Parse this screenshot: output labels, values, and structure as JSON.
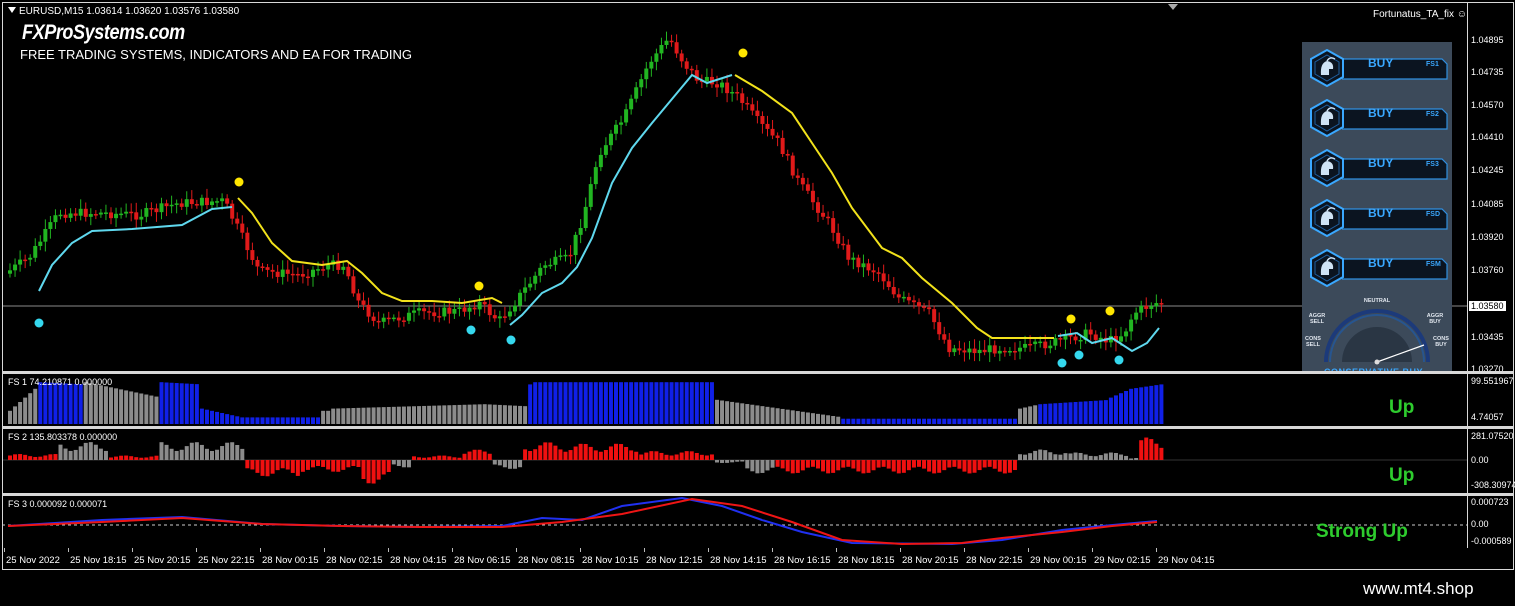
{
  "symbol_line": "EURUSD,M15  1.03614 1.03620 1.03576 1.03580",
  "brand": "FXProSystems.com",
  "tagline": "FREE TRADING SYSTEMS, INDICATORS AND EA FOR TRADING",
  "indicator_name": "Fortunatus_TA_fix",
  "price_labels": [
    "1.04895",
    "1.04735",
    "1.04570",
    "1.04410",
    "1.04245",
    "1.04085",
    "1.03920",
    "1.03760",
    "1.03580",
    "1.03435",
    "1.03270"
  ],
  "current_price": "1.03580",
  "sub1": {
    "header": "FS 1 74.210871 0.000000",
    "scale_top": "99.551967",
    "scale_bottom": "4.74057",
    "state": "Up"
  },
  "sub2": {
    "header": "FS 2 135.803378 0.000000",
    "scale_top": "281.07520",
    "scale_mid": "0.00",
    "scale_bottom": "-308.30974",
    "state": "Up"
  },
  "sub3": {
    "header": "FS 3 0.000092 0.000071",
    "scale_top": "0.000723",
    "scale_mid": "0.00",
    "scale_bottom": "-0.000589",
    "state": "Strong Up"
  },
  "time_labels": [
    "25 Nov 2022",
    "25 Nov 18:15",
    "25 Nov 20:15",
    "25 Nov 22:15",
    "28 Nov 00:15",
    "28 Nov 02:15",
    "28 Nov 04:15",
    "28 Nov 06:15",
    "28 Nov 08:15",
    "28 Nov 10:15",
    "28 Nov 12:15",
    "28 Nov 14:15",
    "28 Nov 16:15",
    "28 Nov 18:15",
    "28 Nov 20:15",
    "28 Nov 22:15",
    "29 Nov 00:15",
    "29 Nov 02:15",
    "29 Nov 04:15"
  ],
  "signal_panel": {
    "buttons": [
      {
        "label": "BUY",
        "code": "FS1"
      },
      {
        "label": "BUY",
        "code": "FS2"
      },
      {
        "label": "BUY",
        "code": "FS3"
      },
      {
        "label": "BUY",
        "code": "FSD"
      },
      {
        "label": "BUY",
        "code": "FSM"
      }
    ],
    "gauge": {
      "neutral": "NEUTRAL",
      "aggr_sell": "AGGR SELL",
      "aggr_buy": "AGGR BUY",
      "cons_sell": "CONS SELL",
      "cons_buy": "CONS BUY",
      "reading": "CONSERVATIVE BUY"
    }
  },
  "footer": "www.mt4.shop",
  "colors": {
    "up": "#21b521",
    "down": "#e01a1a",
    "ma_fast": "#5fd8ee",
    "ma_slow": "#f2e21b",
    "dot_yellow": "#ffe600",
    "dot_cyan": "#35d8ee",
    "hist_blue": "#1020e8",
    "hist_gray": "#8c8c8c",
    "hist_red": "#f01010",
    "state_green": "#2ecc2e"
  }
}
